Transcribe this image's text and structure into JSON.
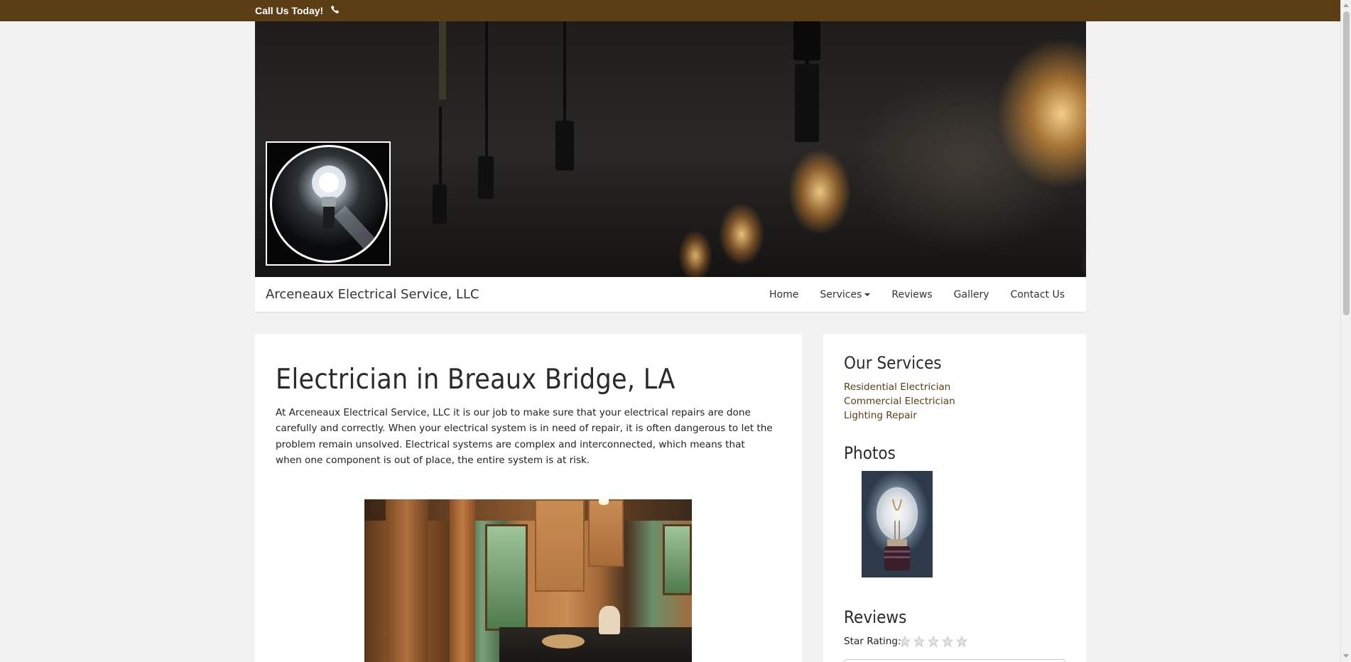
{
  "topbar": {
    "call_text": "Call Us Today!",
    "icon": "phone-icon"
  },
  "hero": {
    "logo_icon": "lightbulb-icon"
  },
  "navbar": {
    "brand": "Arceneaux Electrical Service, LLC",
    "items": [
      {
        "label": "Home"
      },
      {
        "label": "Services"
      },
      {
        "label": "Reviews"
      },
      {
        "label": "Gallery"
      },
      {
        "label": "Contact Us"
      }
    ]
  },
  "main": {
    "title": "Electrician in Breaux Bridge, LA",
    "intro": "At Arceneaux Electrical Service, LLC it is our job to make sure that your electrical repairs are done carefully and correctly. When your electrical system is in need of repair, it is often dangerous to let the problem remain unsolved. Electrical systems are complex and interconnected, which means that when one component is out of place, the entire system is at risk."
  },
  "sidebar": {
    "services_heading": "Our Services",
    "services": [
      {
        "label": "Residential Electrician"
      },
      {
        "label": "Commercial Electrician"
      },
      {
        "label": "Lighting Repair"
      }
    ],
    "photos_heading": "Photos",
    "reviews_heading": "Reviews",
    "star_rating_label": "Star Rating:",
    "star_rating_value": 0,
    "star_rating_max": 5
  },
  "colors": {
    "topbar_bg": "#5b3e15",
    "link": "#5b3e15",
    "page_bg": "#f2f2f2"
  }
}
